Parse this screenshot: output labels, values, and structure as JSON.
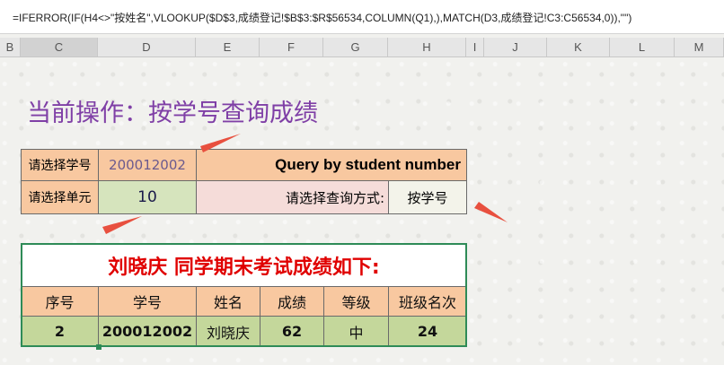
{
  "formula_bar": {
    "text": "=IFERROR(IF(H4<>\"按姓名\",VLOOKUP($D$3,成绩登记!$B$3:$R$56534,COLUMN(Q1),),MATCH(D3,成绩登记!C3:C56534,0)),\"\")"
  },
  "column_headers": [
    "B",
    "C",
    "D",
    "E",
    "F",
    "G",
    "H",
    "I",
    "J",
    "K",
    "L",
    "M"
  ],
  "title": "当前操作：按学号查询成绩",
  "query": {
    "student_id_label": "请选择学号",
    "student_id_value": "200012002",
    "header_text": "Query by student number",
    "unit_label": "请选择单元",
    "unit_value": "10",
    "method_label": "请选择查询方式:",
    "method_value": "按学号"
  },
  "result": {
    "title": "刘晓庆 同学期末考试成绩如下:",
    "headers": [
      "序号",
      "学号",
      "姓名",
      "成绩",
      "等级",
      "班级名次"
    ],
    "values": [
      "2",
      "200012002",
      "刘晓庆",
      "62",
      "中",
      "24"
    ]
  },
  "colors": {
    "title_purple": "#7f3fa6",
    "arrow_red": "#e8503f",
    "result_red": "#e00000",
    "border_green": "#2e8b57"
  }
}
